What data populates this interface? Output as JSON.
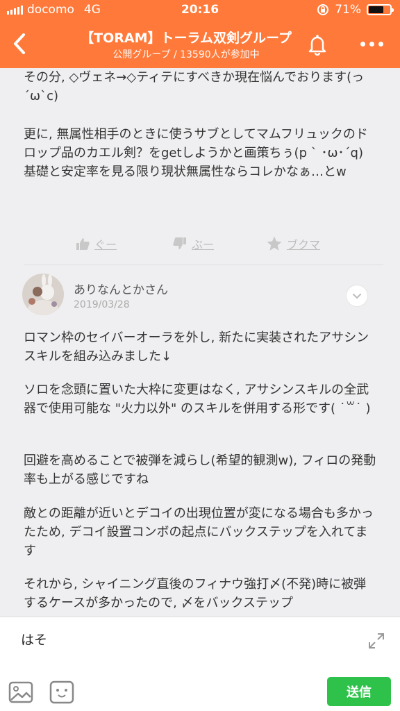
{
  "status_bar": {
    "carrier": "docomo",
    "network": "4G",
    "time": "20:16",
    "battery": "71%",
    "battery_level": 0.71
  },
  "header": {
    "title": "【TORAM】トーラム双剣グループ",
    "subtitle": "公開グループ / 13590人が参加中",
    "back_icon": "chevron-left-icon",
    "bell_icon": "bell-icon",
    "more_icon": "more-dots-icon",
    "color": "#ff7a3a"
  },
  "post1": {
    "para1": "その分, ◇ヴェネ→◇ティテにすべきか現在悩んでおります(っ´ω`c)",
    "para2": "更に, 無属性相手のときに使うサブとしてマムフリュックのドロップ品のカエル剣？をgetしようかと画策ちぅ(p ` ･ω･´q)\n基礎と安定率を見る限り現状無属性ならコレかなぁ…とw",
    "reactions": {
      "good": "ぐー",
      "boo": "ぶー",
      "bookmark": "ブクマ"
    }
  },
  "post2": {
    "author": "ありなんとかさん",
    "date": "2019/03/28",
    "para1": "ロマン枠のセイバーオーラを外し, 新たに実装されたアサシンスキルを組み込みました↓",
    "para2": "ソロを念頭に置いた大枠に変更はなく, アサシンスキルの全武器で使用可能な \"火力以外\" のスキルを併用する形です( ˙꒳˙ )",
    "para3": "回避を高めることで被弾を減らし(希望的観測w), フィロの発動率も上がる感じですね",
    "para4": "敵との距離が近いとデコイの出現位置が変になる場合も多かったため, デコイ設置コンボの起点にバックステップを入れてます",
    "para5": "それから, シャイニング直後のフィナウ強打〆(不発)時に被弾するケースが多かったので, 〆をバックステップ"
  },
  "composer": {
    "text": "はそ",
    "send": "送信",
    "send_color": "#2ec24a"
  }
}
